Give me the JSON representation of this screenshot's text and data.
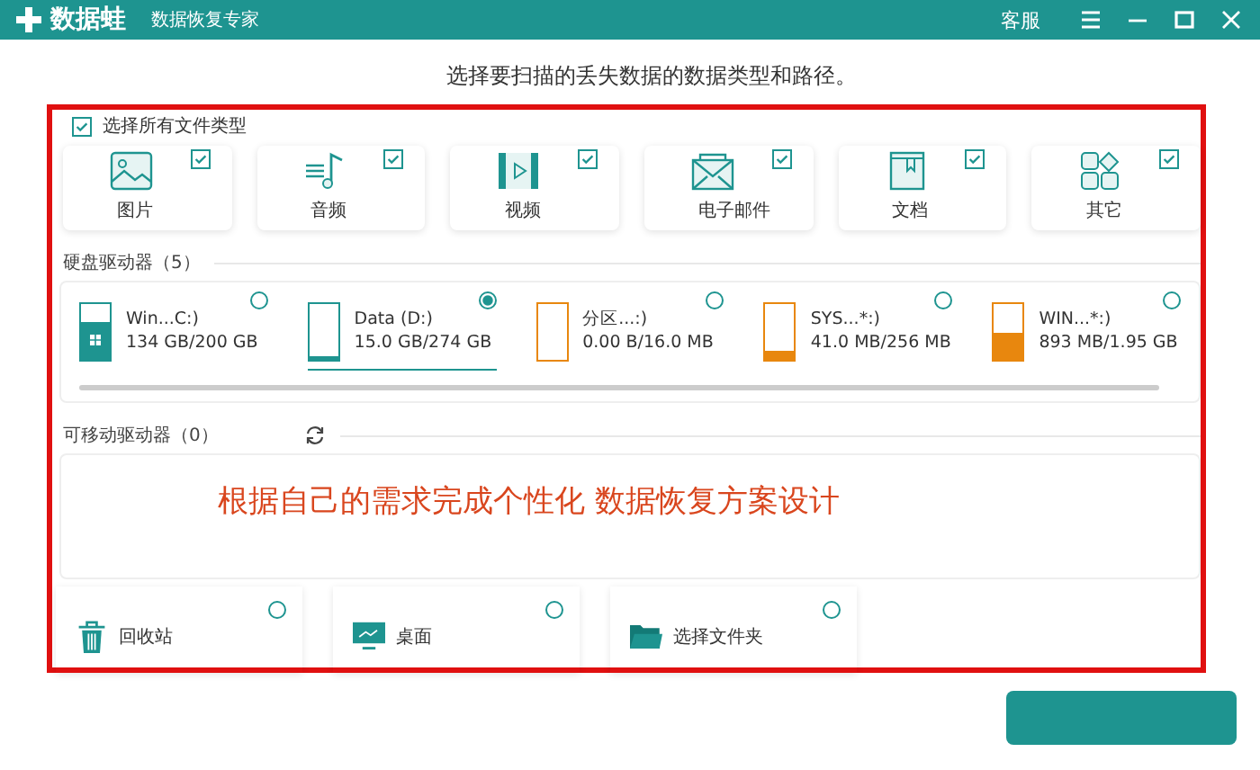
{
  "window": {
    "app_name": "数据蛙",
    "subtitle": "数据恢复专家",
    "service": "客服"
  },
  "heading": "选择要扫描的丢失数据的数据类型和路径。",
  "select_all": {
    "label": "选择所有文件类型",
    "checked": true
  },
  "categories": [
    {
      "kind": "picture",
      "label": "图片",
      "checked": true
    },
    {
      "kind": "audio",
      "label": "音频",
      "checked": true
    },
    {
      "kind": "video",
      "label": "视频",
      "checked": true
    },
    {
      "kind": "email",
      "label": "电子邮件",
      "checked": true
    },
    {
      "kind": "document",
      "label": "文档",
      "checked": true
    },
    {
      "kind": "other",
      "label": "其它",
      "checked": true
    }
  ],
  "hard_drives": {
    "title": "硬盘驱动器（5）",
    "drives": [
      {
        "name": "Win...C:)",
        "size": "134 GB/200 GB",
        "level": 0.67,
        "color": "#1e9490",
        "system": true,
        "selected": false
      },
      {
        "name": "Data (D:)",
        "size": "15.0 GB/274 GB",
        "level": 0.06,
        "color": "#1e9490",
        "system": false,
        "selected": true
      },
      {
        "name": "分区...:)",
        "size": "0.00  B/16.0 MB",
        "level": 0,
        "color": "#e8870e",
        "system": false,
        "selected": false
      },
      {
        "name": "SYS...*:)",
        "size": "41.0 MB/256 MB",
        "level": 0.16,
        "color": "#e8870e",
        "system": false,
        "selected": false
      },
      {
        "name": "WIN...*:)",
        "size": "893 MB/1.95 GB",
        "level": 0.46,
        "color": "#e8870e",
        "system": false,
        "selected": false
      }
    ]
  },
  "removable": {
    "title": "可移动驱动器（0）"
  },
  "annotation": "根据自己的需求完成个性化 数据恢复方案设计",
  "locations": [
    {
      "kind": "trash",
      "label": "回收站",
      "selected": false
    },
    {
      "kind": "desktop",
      "label": "桌面",
      "selected": false
    },
    {
      "kind": "folder",
      "label": "选择文件夹",
      "selected": false
    }
  ]
}
